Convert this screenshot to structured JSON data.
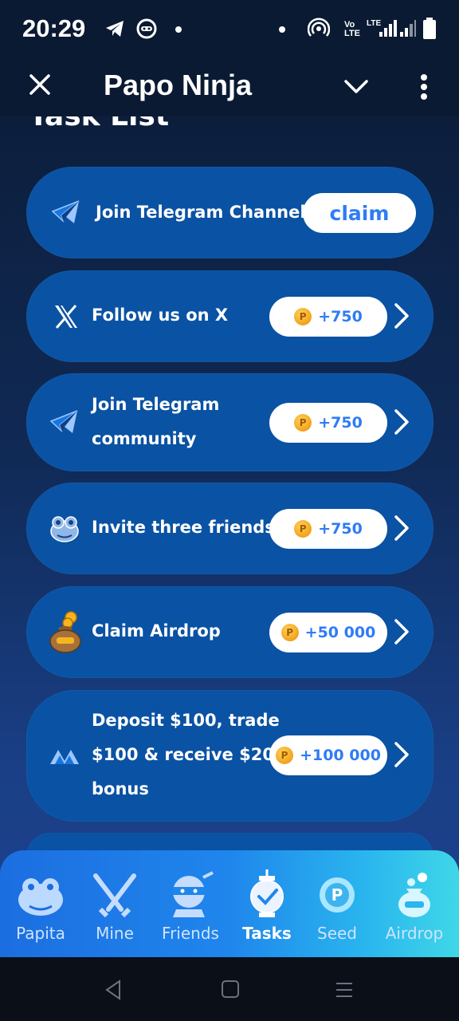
{
  "status_bar": {
    "time": "20:29",
    "net_label_1": "Vo",
    "net_label_2": "LTE",
    "net_label_3": "LTE",
    "icons": [
      "telegram-icon",
      "headset-bot-icon",
      "hotspot-icon",
      "signal-icon",
      "battery-icon"
    ]
  },
  "header": {
    "title": "Papo Ninja",
    "icons": [
      "close-icon",
      "chevron-down-icon",
      "more-vertical-icon"
    ]
  },
  "page": {
    "heading": "Task List"
  },
  "tasks": [
    {
      "label": "Join Telegram Channel",
      "action": "claim",
      "icon": "telegram-icon"
    },
    {
      "label": "Follow us on X",
      "reward": "+750",
      "icon": "x-logo-icon"
    },
    {
      "label_line1": "Join Telegram",
      "label_line2": "community",
      "reward": "+750",
      "icon": "telegram-icon"
    },
    {
      "label": "Invite three friends",
      "reward": "+750",
      "icon": "frog-icon"
    },
    {
      "label": "Claim Airdrop",
      "reward": "+50 000",
      "icon": "money-bag-icon"
    },
    {
      "label_line1": "Deposit $100, trade",
      "label_line2": "$100 & receive $20",
      "label_line3": "bonus",
      "reward": "+100 000",
      "icon": "mexc-logo-icon"
    }
  ],
  "coin_symbol": "P",
  "bottom_nav": [
    {
      "label": "Papita",
      "icon": "frog-icon"
    },
    {
      "label": "Mine",
      "icon": "swords-icon"
    },
    {
      "label": "Friends",
      "icon": "ninja-icon"
    },
    {
      "label": "Tasks",
      "icon": "lantern-icon",
      "active": true
    },
    {
      "label": "Seed",
      "icon": "coin-icon"
    },
    {
      "label": "Airdrop",
      "icon": "papo-bag-icon"
    }
  ],
  "colors": {
    "card": "#0a52a3",
    "accent_text": "#2e7cf6",
    "nav_gradient_start": "#1c6ee0",
    "nav_gradient_end": "#3fd7e8"
  }
}
